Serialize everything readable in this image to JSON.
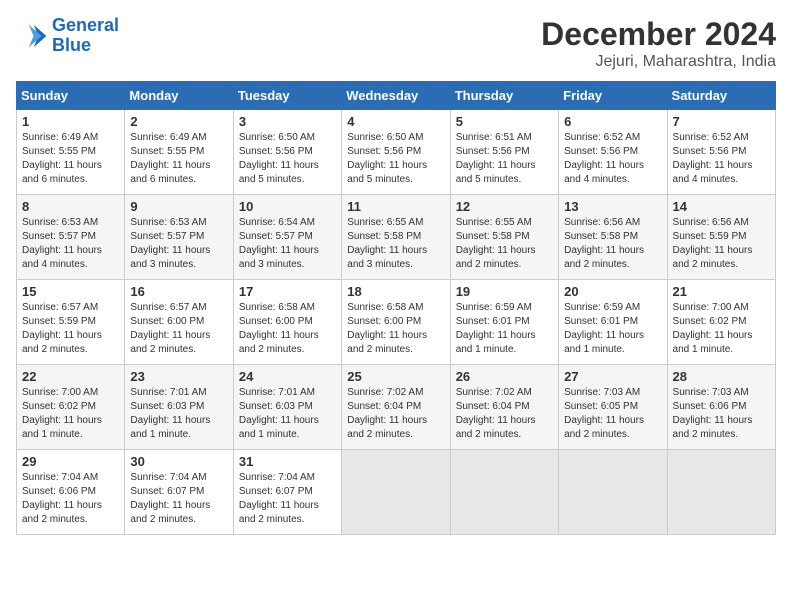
{
  "header": {
    "logo_line1": "General",
    "logo_line2": "Blue",
    "month": "December 2024",
    "location": "Jejuri, Maharashtra, India"
  },
  "days_of_week": [
    "Sunday",
    "Monday",
    "Tuesday",
    "Wednesday",
    "Thursday",
    "Friday",
    "Saturday"
  ],
  "weeks": [
    [
      {
        "day": "1",
        "info": "Sunrise: 6:49 AM\nSunset: 5:55 PM\nDaylight: 11 hours\nand 6 minutes."
      },
      {
        "day": "2",
        "info": "Sunrise: 6:49 AM\nSunset: 5:55 PM\nDaylight: 11 hours\nand 6 minutes."
      },
      {
        "day": "3",
        "info": "Sunrise: 6:50 AM\nSunset: 5:56 PM\nDaylight: 11 hours\nand 5 minutes."
      },
      {
        "day": "4",
        "info": "Sunrise: 6:50 AM\nSunset: 5:56 PM\nDaylight: 11 hours\nand 5 minutes."
      },
      {
        "day": "5",
        "info": "Sunrise: 6:51 AM\nSunset: 5:56 PM\nDaylight: 11 hours\nand 5 minutes."
      },
      {
        "day": "6",
        "info": "Sunrise: 6:52 AM\nSunset: 5:56 PM\nDaylight: 11 hours\nand 4 minutes."
      },
      {
        "day": "7",
        "info": "Sunrise: 6:52 AM\nSunset: 5:56 PM\nDaylight: 11 hours\nand 4 minutes."
      }
    ],
    [
      {
        "day": "8",
        "info": "Sunrise: 6:53 AM\nSunset: 5:57 PM\nDaylight: 11 hours\nand 4 minutes."
      },
      {
        "day": "9",
        "info": "Sunrise: 6:53 AM\nSunset: 5:57 PM\nDaylight: 11 hours\nand 3 minutes."
      },
      {
        "day": "10",
        "info": "Sunrise: 6:54 AM\nSunset: 5:57 PM\nDaylight: 11 hours\nand 3 minutes."
      },
      {
        "day": "11",
        "info": "Sunrise: 6:55 AM\nSunset: 5:58 PM\nDaylight: 11 hours\nand 3 minutes."
      },
      {
        "day": "12",
        "info": "Sunrise: 6:55 AM\nSunset: 5:58 PM\nDaylight: 11 hours\nand 2 minutes."
      },
      {
        "day": "13",
        "info": "Sunrise: 6:56 AM\nSunset: 5:58 PM\nDaylight: 11 hours\nand 2 minutes."
      },
      {
        "day": "14",
        "info": "Sunrise: 6:56 AM\nSunset: 5:59 PM\nDaylight: 11 hours\nand 2 minutes."
      }
    ],
    [
      {
        "day": "15",
        "info": "Sunrise: 6:57 AM\nSunset: 5:59 PM\nDaylight: 11 hours\nand 2 minutes."
      },
      {
        "day": "16",
        "info": "Sunrise: 6:57 AM\nSunset: 6:00 PM\nDaylight: 11 hours\nand 2 minutes."
      },
      {
        "day": "17",
        "info": "Sunrise: 6:58 AM\nSunset: 6:00 PM\nDaylight: 11 hours\nand 2 minutes."
      },
      {
        "day": "18",
        "info": "Sunrise: 6:58 AM\nSunset: 6:00 PM\nDaylight: 11 hours\nand 2 minutes."
      },
      {
        "day": "19",
        "info": "Sunrise: 6:59 AM\nSunset: 6:01 PM\nDaylight: 11 hours\nand 1 minute."
      },
      {
        "day": "20",
        "info": "Sunrise: 6:59 AM\nSunset: 6:01 PM\nDaylight: 11 hours\nand 1 minute."
      },
      {
        "day": "21",
        "info": "Sunrise: 7:00 AM\nSunset: 6:02 PM\nDaylight: 11 hours\nand 1 minute."
      }
    ],
    [
      {
        "day": "22",
        "info": "Sunrise: 7:00 AM\nSunset: 6:02 PM\nDaylight: 11 hours\nand 1 minute."
      },
      {
        "day": "23",
        "info": "Sunrise: 7:01 AM\nSunset: 6:03 PM\nDaylight: 11 hours\nand 1 minute."
      },
      {
        "day": "24",
        "info": "Sunrise: 7:01 AM\nSunset: 6:03 PM\nDaylight: 11 hours\nand 1 minute."
      },
      {
        "day": "25",
        "info": "Sunrise: 7:02 AM\nSunset: 6:04 PM\nDaylight: 11 hours\nand 2 minutes."
      },
      {
        "day": "26",
        "info": "Sunrise: 7:02 AM\nSunset: 6:04 PM\nDaylight: 11 hours\nand 2 minutes."
      },
      {
        "day": "27",
        "info": "Sunrise: 7:03 AM\nSunset: 6:05 PM\nDaylight: 11 hours\nand 2 minutes."
      },
      {
        "day": "28",
        "info": "Sunrise: 7:03 AM\nSunset: 6:06 PM\nDaylight: 11 hours\nand 2 minutes."
      }
    ],
    [
      {
        "day": "29",
        "info": "Sunrise: 7:04 AM\nSunset: 6:06 PM\nDaylight: 11 hours\nand 2 minutes."
      },
      {
        "day": "30",
        "info": "Sunrise: 7:04 AM\nSunset: 6:07 PM\nDaylight: 11 hours\nand 2 minutes."
      },
      {
        "day": "31",
        "info": "Sunrise: 7:04 AM\nSunset: 6:07 PM\nDaylight: 11 hours\nand 2 minutes."
      },
      {
        "day": "",
        "info": ""
      },
      {
        "day": "",
        "info": ""
      },
      {
        "day": "",
        "info": ""
      },
      {
        "day": "",
        "info": ""
      }
    ]
  ]
}
